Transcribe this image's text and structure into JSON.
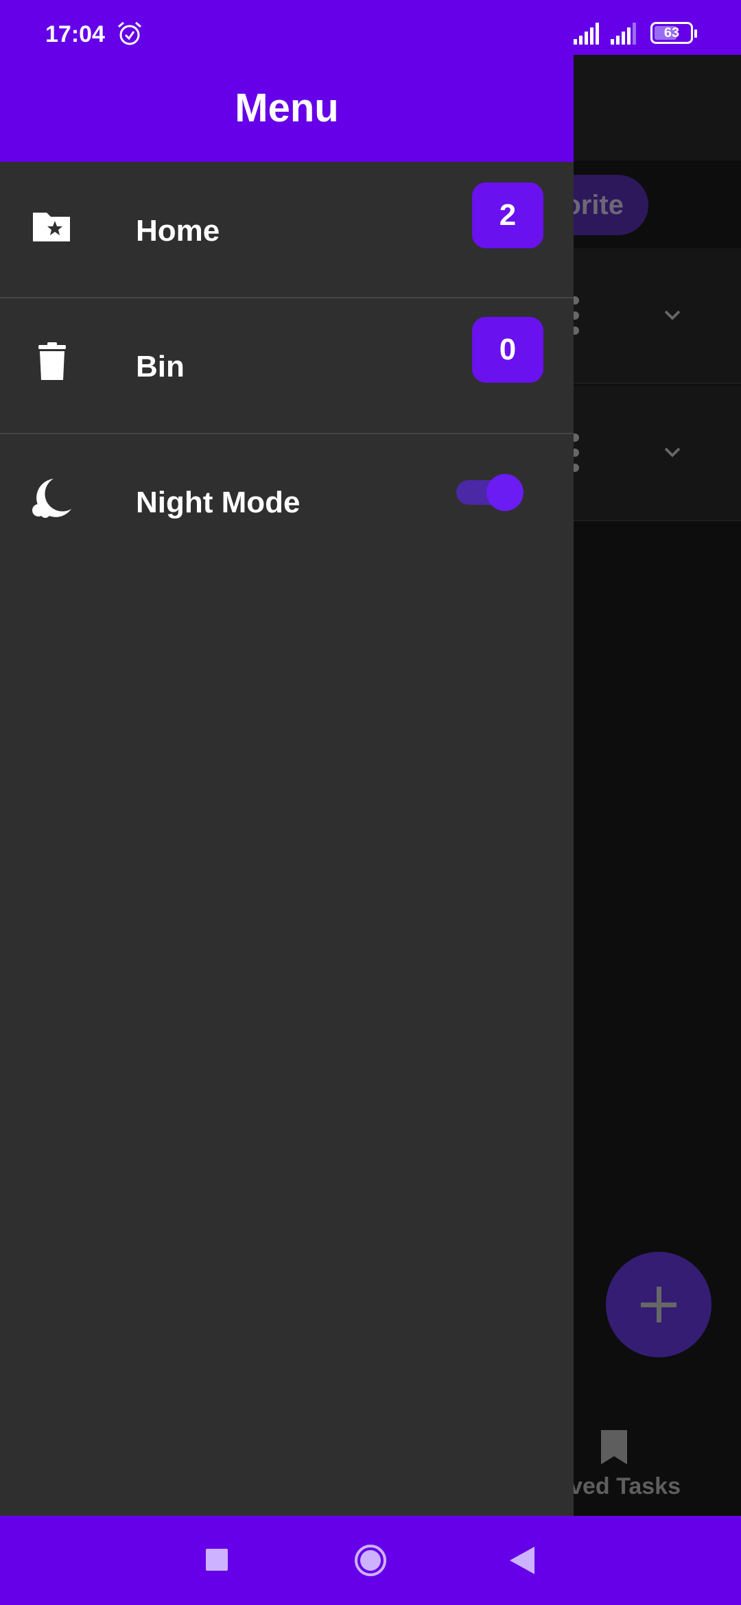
{
  "status_bar": {
    "time": "17:04",
    "battery_level": "63",
    "battery_fraction": 0.63,
    "icons": [
      "alarm-icon",
      "signal-icon",
      "signal-icon",
      "battery-icon"
    ]
  },
  "drawer": {
    "title": "Menu",
    "items": [
      {
        "label": "Home",
        "icon": "folder-star-icon",
        "count": "2"
      },
      {
        "label": "Bin",
        "icon": "trash-icon",
        "count": "0"
      },
      {
        "label": "Night Mode",
        "icon": "moon-icon",
        "toggle_on": true
      }
    ]
  },
  "background": {
    "chip_label": "orite",
    "bottom_nav_label": "aved Tasks",
    "bottom_nav_icon": "bookmark-icon",
    "fab_icon": "plus-icon"
  },
  "nav_bar": {
    "buttons": [
      "recents-icon",
      "home-icon",
      "back-icon"
    ]
  },
  "colors": {
    "accent": "#6600e8",
    "badge": "#6a11ef",
    "drawer_bg": "#2f2f2f",
    "toggle_track": "#4a28a6"
  }
}
